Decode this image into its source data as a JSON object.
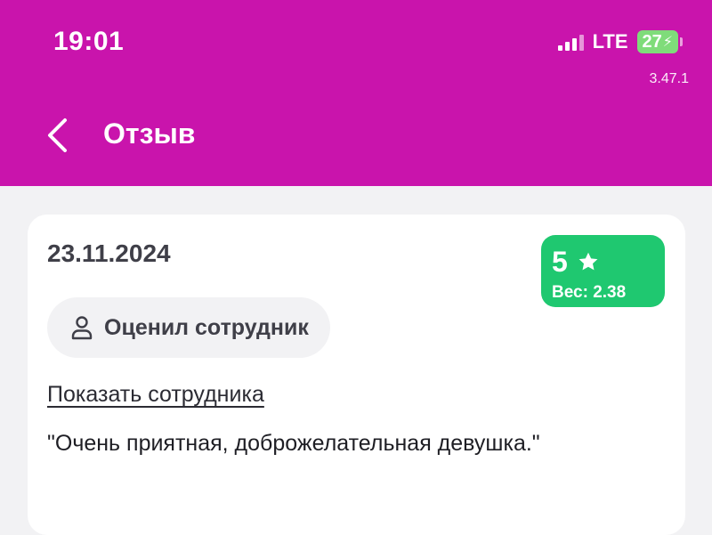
{
  "status_bar": {
    "time": "19:01",
    "network": "LTE",
    "battery": "27",
    "signal_icon": "cellular-signal-icon",
    "charging_icon": "lightning-bolt-icon"
  },
  "app_version": "3.47.1",
  "header": {
    "title": "Отзыв",
    "back_icon": "chevron-left-icon"
  },
  "review": {
    "date": "23.11.2024",
    "rating": "5",
    "rating_icon": "star-icon",
    "weight": "Вес: 2.38",
    "author_chip": "Оценил сотрудник",
    "author_icon": "person-icon",
    "show_employee_link": "Показать сотрудника",
    "text": "\"Очень приятная, доброжелательная девушка.\""
  },
  "colors": {
    "header_bg": "#c914ac",
    "rating_bg": "#1fc870",
    "battery_bg": "#7fdc7a",
    "page_bg": "#f2f2f4",
    "card_bg": "#ffffff"
  }
}
